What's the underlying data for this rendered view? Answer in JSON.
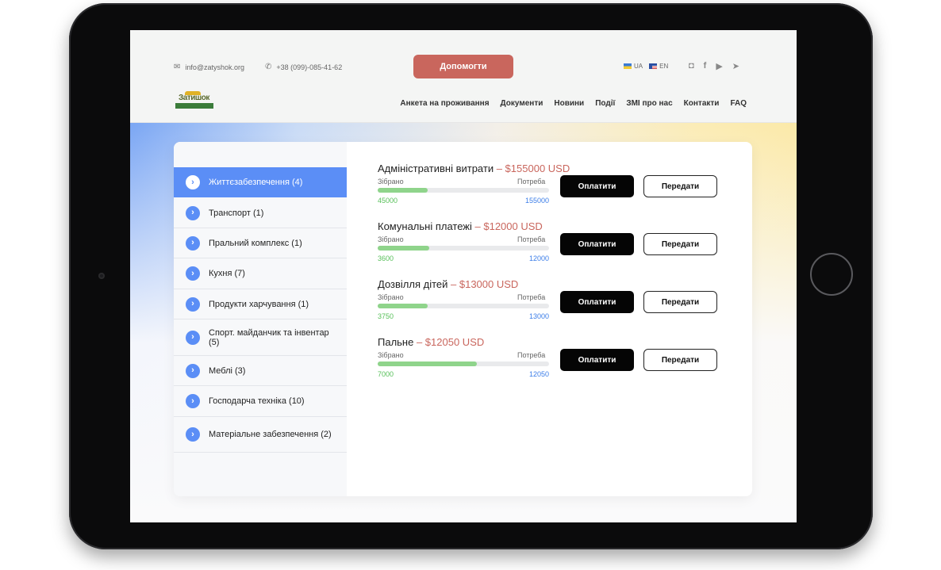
{
  "header": {
    "email": "info@zatyshok.org",
    "phone": "+38 (099)-085-41-62",
    "help_button": "Допомогти",
    "lang_ua": "UA",
    "lang_en": "EN",
    "social_icons": [
      "instagram-icon",
      "facebook-icon",
      "youtube-icon",
      "telegram-icon"
    ]
  },
  "logo": {
    "text": "Затишок"
  },
  "nav": [
    "Анкета на проживання",
    "Документи",
    "Новини",
    "Події",
    "ЗМІ про нас",
    "Контакти",
    "FAQ"
  ],
  "sidebar": {
    "items": [
      {
        "label": "Життєзабезпечення (4)",
        "active": true
      },
      {
        "label": "Транспорт (1)"
      },
      {
        "label": "Пральний комплекс (1)"
      },
      {
        "label": "Кухня (7)"
      },
      {
        "label": "Продукти харчування (1)"
      },
      {
        "label": "Спорт. майданчик та інвентар (5)"
      },
      {
        "label": "Меблі (3)"
      },
      {
        "label": "Господарча техніка (10)"
      },
      {
        "label": "Матеріальне забезпечення (2)"
      }
    ]
  },
  "needs": [
    {
      "title": "Адміністративні витрати",
      "amount": "– $155000 USD",
      "collected": "45000",
      "needed": "155000",
      "fill": 0.29
    },
    {
      "title": "Комунальні платежі",
      "amount": "– $12000 USD",
      "collected": "3600",
      "needed": "12000",
      "fill": 0.3
    },
    {
      "title": "Дозвілля дітей",
      "amount": "– $13000 USD",
      "collected": "3750",
      "needed": "13000",
      "fill": 0.29
    },
    {
      "title": "Пальне",
      "amount": "– $12050 USD",
      "collected": "7000",
      "needed": "12050",
      "fill": 0.58
    }
  ],
  "labels": {
    "collected": "Зібрано",
    "needed": "Потреба",
    "pay": "Оплатити",
    "give": "Передати"
  },
  "colors": {
    "accent_blue": "#5b8ef6",
    "help_red": "#c9665d",
    "progress_green": "#8fd48b"
  }
}
